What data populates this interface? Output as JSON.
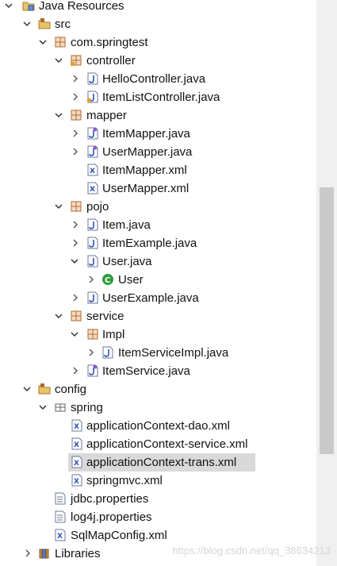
{
  "tree": [
    {
      "label": "Java Resources",
      "icon": "java-resources-icon"
    },
    {
      "label": "src",
      "icon": "source-folder-icon"
    },
    {
      "label": "com.springtest",
      "icon": "package-icon"
    },
    {
      "label": "controller",
      "icon": "package-icon"
    },
    {
      "label": "HelloController.java",
      "icon": "java-file-icon"
    },
    {
      "label": "ItemListController.java",
      "icon": "java-file-icon"
    },
    {
      "label": "mapper",
      "icon": "package-icon"
    },
    {
      "label": "ItemMapper.java",
      "icon": "java-interface-file-icon"
    },
    {
      "label": "UserMapper.java",
      "icon": "java-interface-file-icon"
    },
    {
      "label": "ItemMapper.xml",
      "icon": "xml-file-icon"
    },
    {
      "label": "UserMapper.xml",
      "icon": "xml-file-icon"
    },
    {
      "label": "pojo",
      "icon": "package-icon"
    },
    {
      "label": "Item.java",
      "icon": "java-file-icon"
    },
    {
      "label": "ItemExample.java",
      "icon": "java-file-icon"
    },
    {
      "label": "User.java",
      "icon": "java-file-icon"
    },
    {
      "label": "User",
      "icon": "class-icon"
    },
    {
      "label": "UserExample.java",
      "icon": "java-file-icon"
    },
    {
      "label": "service",
      "icon": "package-icon"
    },
    {
      "label": "Impl",
      "icon": "package-icon"
    },
    {
      "label": "ItemServiceImpl.java",
      "icon": "java-file-icon"
    },
    {
      "label": "ItemService.java",
      "icon": "java-interface-file-icon"
    },
    {
      "label": "config",
      "icon": "source-folder-icon"
    },
    {
      "label": "spring",
      "icon": "empty-package-icon"
    },
    {
      "label": "applicationContext-dao.xml",
      "icon": "xml-file-icon"
    },
    {
      "label": "applicationContext-service.xml",
      "icon": "xml-file-icon"
    },
    {
      "label": "applicationContext-trans.xml",
      "icon": "xml-file-icon",
      "selected": true
    },
    {
      "label": "springmvc.xml",
      "icon": "xml-file-icon"
    },
    {
      "label": "jdbc.properties",
      "icon": "properties-file-icon"
    },
    {
      "label": "log4j.properties",
      "icon": "properties-file-icon"
    },
    {
      "label": "SqlMapConfig.xml",
      "icon": "xml-file-icon"
    },
    {
      "label": "Libraries",
      "icon": "libraries-icon"
    }
  ],
  "watermark": "https://blog.csdn.net/qq_38634213",
  "colors": {
    "selection": "#d9d9d9",
    "package": "#b3692e",
    "java": "#2a52be",
    "class": "#2e9e3d"
  }
}
